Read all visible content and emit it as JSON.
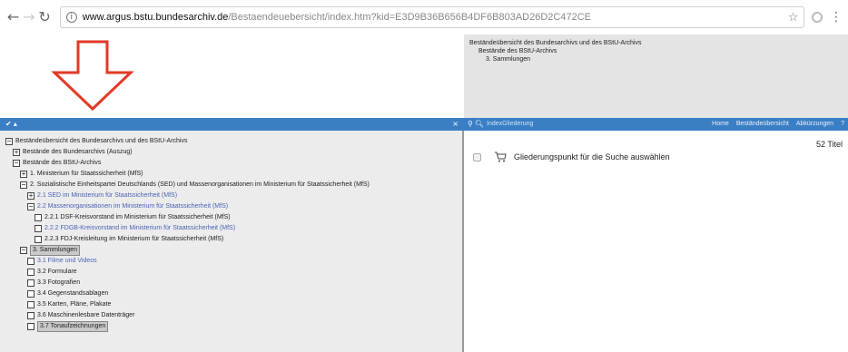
{
  "browser": {
    "url_host": "www.argus.bstu.bundesarchiv.de",
    "url_path": "/Bestaendeuebersicht/index.htm?kid=E3D9B36B656B4DF6B803AD26D2C472CE",
    "icons": [
      "back-icon",
      "forward-icon",
      "reload-icon",
      "info-icon",
      "star-icon",
      "extension-icon",
      "menu-icon"
    ]
  },
  "breadcrumb": {
    "line1": "Beständeübersicht des Bundesarchivs und des BStU-Archivs",
    "line2": "Bestände des BStU-Archivs",
    "line3": "3. Sammlungen"
  },
  "left_bar": {
    "label": "✔ ▴",
    "close": "×"
  },
  "right_bar": {
    "tab_label": "IndexGliederung",
    "links": [
      "Home",
      "Beständeübersicht",
      "Abkürzungen",
      "?"
    ]
  },
  "tree": [
    {
      "text": "Beständeübersicht des Bundesarchivs und des BStU-Archivs",
      "sign": "−",
      "level": 0,
      "style": ""
    },
    {
      "text": "Bestände des Bundesarchivs (Auszug)",
      "sign": "+",
      "level": 1,
      "style": ""
    },
    {
      "text": "Bestände des BStU-Archivs",
      "sign": "−",
      "level": 1,
      "style": ""
    },
    {
      "text": "1. Ministerium für Staatssicherheit (MfS)",
      "sign": "+",
      "level": 2,
      "style": ""
    },
    {
      "text": "2. Sozialistische Einheitspartei Deutschlands (SED) und Massenorganisationen im Ministerium für Staatssicherheit (MfS)",
      "sign": "−",
      "level": 2,
      "style": ""
    },
    {
      "text": "2.1 SED im Ministerium für Staatssicherheit (MfS)",
      "sign": "+",
      "level": 3,
      "style": "link"
    },
    {
      "text": "2.2 Massenorganisationen im Ministerium für Staatssicherheit (MfS)",
      "sign": "−",
      "level": 3,
      "style": "link"
    },
    {
      "text": "2.2.1 DSF-Kreisvorstand im Ministerium für Staatssicherheit (MfS)",
      "sign": "",
      "level": 4,
      "style": ""
    },
    {
      "text": "2.2.2 FDGB-Kreisvorstand im Ministerium für Staatssicherheit (MfS)",
      "sign": "",
      "level": 4,
      "style": "link"
    },
    {
      "text": "2.2.3 FDJ-Kreisleitung im Ministerium für Staatssicherheit (MfS)",
      "sign": "",
      "level": 4,
      "style": ""
    },
    {
      "text": "3. Sammlungen",
      "sign": "−",
      "level": 2,
      "style": "selected"
    },
    {
      "text": "3.1 Filme und Videos",
      "sign": "",
      "level": 3,
      "style": "link"
    },
    {
      "text": "3.2 Formulare",
      "sign": "",
      "level": 3,
      "style": ""
    },
    {
      "text": "3.3 Fotografien",
      "sign": "",
      "level": 3,
      "style": ""
    },
    {
      "text": "3.4 Gegenstandsablagen",
      "sign": "",
      "level": 3,
      "style": ""
    },
    {
      "text": "3.5 Karten, Pläne, Plakate",
      "sign": "",
      "level": 3,
      "style": ""
    },
    {
      "text": "3.6 Maschinenlesbare Datenträger",
      "sign": "",
      "level": 3,
      "style": ""
    },
    {
      "text": "3.7 Tonaufzeichnungen",
      "sign": "",
      "level": 3,
      "style": "selected"
    }
  ],
  "result": {
    "count": "52 Titel",
    "search_label": "Gliederungspunkt für die Suche auswählen"
  },
  "colors": {
    "bar_blue": "#3a7fc4",
    "arrow_red": "#e23a26",
    "link_blue": "#4a63b5"
  }
}
